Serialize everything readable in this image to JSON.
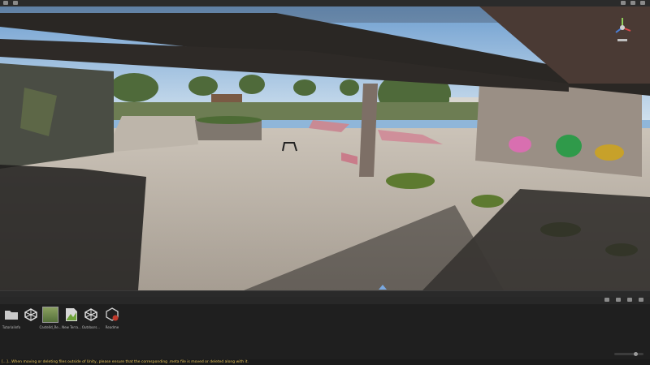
{
  "project": {
    "assets": [
      {
        "label": "Tutorialinfo",
        "icon": "folder-icon"
      },
      {
        "label": "",
        "icon": "unity-scene-icon"
      },
      {
        "label": "Castelld_Re...",
        "icon": "terrain-icon"
      },
      {
        "label": "New Terra...",
        "icon": "terrain-data-icon"
      },
      {
        "label": "Outdoors...",
        "icon": "unity-scene-icon"
      },
      {
        "label": "Readme",
        "icon": "readme-icon"
      }
    ]
  },
  "status": {
    "message": "[...]...When moving or deleting files outside of Unity, please ensure that the corresponding .meta file is moved or deleted along with it."
  },
  "colors": {
    "status_warning": "#e7c45a",
    "editor_bg": "#1e1e1e",
    "accent": "#7aa8e0"
  }
}
